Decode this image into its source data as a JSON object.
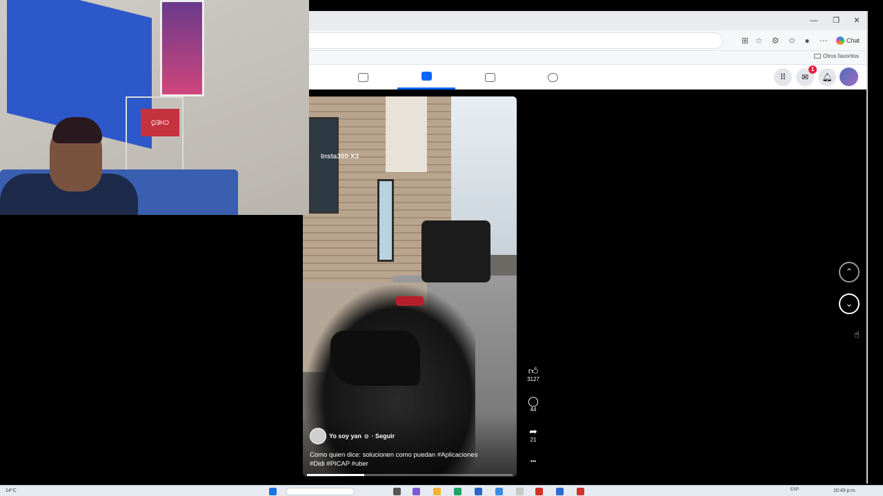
{
  "browser": {
    "window_controls": {
      "minimize": "—",
      "maximize": "❐",
      "close": "✕"
    },
    "chat_label": "Chat",
    "favorites_label": "Otros favoritos"
  },
  "facebook_nav": {
    "tabs": [
      {
        "icon": "feed-icon",
        "active": false
      },
      {
        "icon": "reels-icon",
        "active": true
      },
      {
        "icon": "marketplace-icon",
        "active": false
      },
      {
        "icon": "gaming-icon",
        "active": false
      }
    ],
    "messenger_badge": "1"
  },
  "reel": {
    "watermark": "Insta360  X3",
    "author_name": "Yo soy yan",
    "follow_label": "· Seguir",
    "caption_line1": "Como quien dice: solucionen como puedan   #Aplicaciones",
    "caption_line2": "#Didi #PICAP #uber",
    "progress": 0.28
  },
  "actions": {
    "likes": "3127",
    "comments": "44",
    "shares": "21",
    "more": "•••"
  },
  "navigation": {
    "up_glyph": "⌃",
    "down_glyph": "⌄"
  },
  "webcam": {
    "sign_text": "CHEQ"
  },
  "taskbar": {
    "weather": "14°C",
    "language": "ESP",
    "time": "10:43 p.m."
  }
}
